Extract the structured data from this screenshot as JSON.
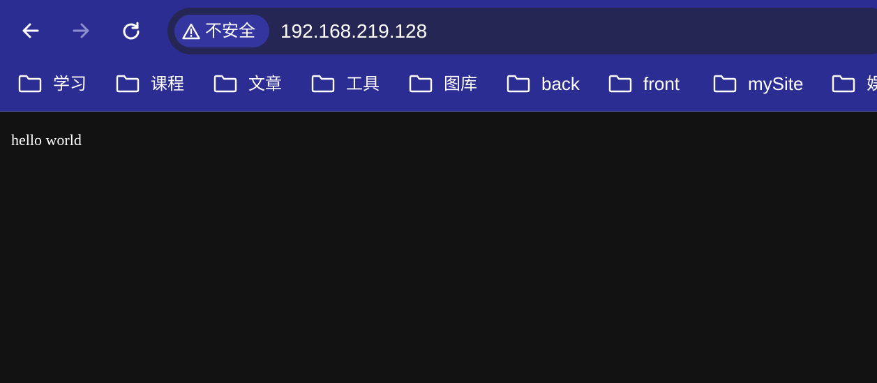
{
  "browser": {
    "nav": {
      "back_icon": "arrow-left-icon",
      "forward_icon": "arrow-right-icon",
      "reload_icon": "reload-icon"
    },
    "address_bar": {
      "security_icon": "warning-triangle-icon",
      "security_label": "不安全",
      "url": "192.168.219.128"
    },
    "bookmarks": [
      {
        "label": "学习",
        "icon": "folder-icon"
      },
      {
        "label": "课程",
        "icon": "folder-icon"
      },
      {
        "label": "文章",
        "icon": "folder-icon"
      },
      {
        "label": "工具",
        "icon": "folder-icon"
      },
      {
        "label": "图库",
        "icon": "folder-icon"
      },
      {
        "label": "back",
        "icon": "folder-icon"
      },
      {
        "label": "front",
        "icon": "folder-icon"
      },
      {
        "label": "mySite",
        "icon": "folder-icon"
      },
      {
        "label": "娱",
        "icon": "folder-icon"
      }
    ]
  },
  "page": {
    "body_text": "hello world"
  },
  "colors": {
    "toolbar_bg": "#2c2d93",
    "omnibox_bg": "#262654",
    "chip_bg": "#34359f",
    "page_bg": "#121212",
    "text": "#ffffff",
    "forward_disabled": "#8e8fd0"
  }
}
